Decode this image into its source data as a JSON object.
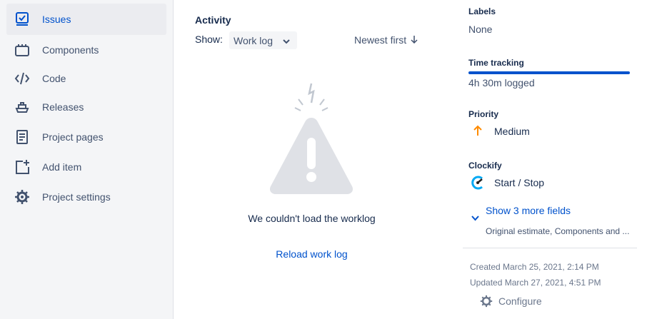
{
  "sidebar": {
    "items": [
      {
        "label": "Issues",
        "icon": "issues-icon",
        "active": true
      },
      {
        "label": "Components",
        "icon": "components-icon"
      },
      {
        "label": "Code",
        "icon": "code-icon"
      },
      {
        "label": "Releases",
        "icon": "releases-icon"
      },
      {
        "label": "Project pages",
        "icon": "project-pages-icon"
      },
      {
        "label": "Add item",
        "icon": "add-item-icon"
      },
      {
        "label": "Project settings",
        "icon": "gear-icon"
      }
    ]
  },
  "activity": {
    "title": "Activity",
    "show_label": "Show:",
    "show_value": "Work log",
    "sort_label": "Newest first",
    "error_message": "We couldn't load the worklog",
    "reload_label": "Reload work log"
  },
  "fields": {
    "labels": {
      "label": "Labels",
      "value": "None"
    },
    "time_tracking": {
      "label": "Time tracking",
      "value": "4h 30m logged",
      "progress": 1.0
    },
    "priority": {
      "label": "Priority",
      "value": "Medium",
      "color": "#ff8b00"
    },
    "clockify": {
      "label": "Clockify",
      "value": "Start / Stop",
      "color": "#03a9f4"
    },
    "more_fields": {
      "label": "Show 3 more fields",
      "sub": "Original estimate, Components and ..."
    },
    "created": "Created March 25, 2021, 2:14 PM",
    "updated": "Updated March 27, 2021, 4:51 PM",
    "configure_label": "Configure"
  },
  "colors": {
    "accent": "#0052cc",
    "sidebar_bg": "#f4f5f7"
  }
}
